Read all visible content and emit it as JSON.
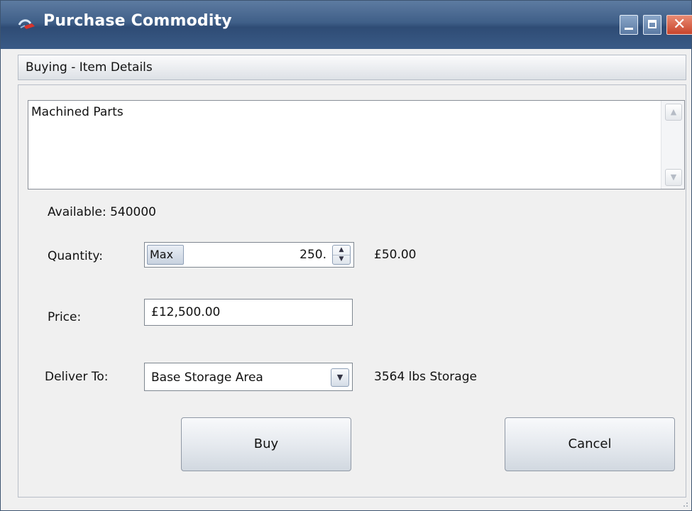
{
  "window": {
    "title": "Purchase Commodity",
    "controls": {
      "minimize": "minimize",
      "maximize": "maximize",
      "close": "close"
    }
  },
  "section": {
    "label": "Buying - Item Details"
  },
  "item": {
    "description": "Machined Parts"
  },
  "availability": {
    "text": "Available: 540000"
  },
  "quantity": {
    "label": "Quantity:",
    "max_label": "Max",
    "value": "250.",
    "unit_price": "£50.00"
  },
  "price": {
    "label": "Price:",
    "value": "£12,500.00"
  },
  "delivery": {
    "label": "Deliver To:",
    "selected": "Base Storage Area",
    "storage_info": "3564 lbs Storage"
  },
  "actions": {
    "buy_label": "Buy",
    "cancel_label": "Cancel"
  },
  "colors": {
    "titlebar": "#3f5f88",
    "close_button": "#d0553a",
    "panel_bg": "#f0f0f0"
  }
}
